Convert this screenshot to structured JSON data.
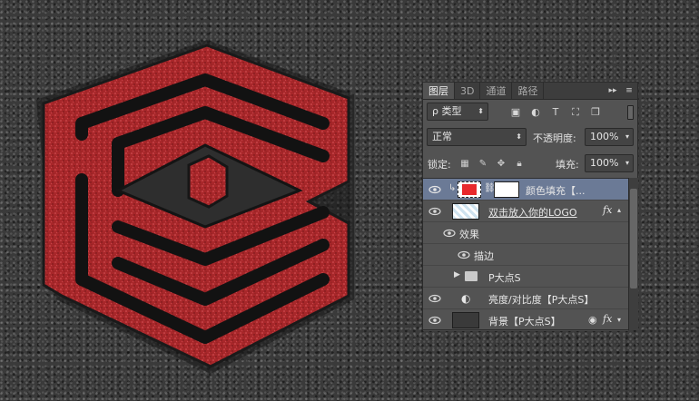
{
  "panel": {
    "tabs": [
      {
        "label": "图层",
        "active": true
      },
      {
        "label": "3D",
        "active": false
      },
      {
        "label": "通道",
        "active": false
      },
      {
        "label": "路径",
        "active": false
      }
    ],
    "filter": {
      "label": "ρ 类型"
    },
    "blend_mode": "正常",
    "opacity_label": "不透明度:",
    "opacity_value": "100%",
    "lock_label": "锁定:",
    "fill_label": "填充:",
    "fill_value": "100%",
    "layers": [
      {
        "name": "颜色填充【...",
        "type": "color-fill",
        "selected": true,
        "fill_color": "#e8292d"
      },
      {
        "name": "双击放入你的LOGO",
        "type": "smart-object",
        "has_fx": true
      },
      {
        "name": "效果",
        "type": "effects-header"
      },
      {
        "name": "描边",
        "type": "effect"
      },
      {
        "name": "P大点S",
        "type": "group"
      },
      {
        "name": "亮度/对比度【P大点S】",
        "type": "adjustment"
      },
      {
        "name": "背景【P大点S】",
        "type": "background",
        "has_fx": true
      }
    ]
  },
  "colors": {
    "logo_red": "#a8272a",
    "selection": "#6b7a96",
    "panel_bg": "#535353"
  },
  "icons": [
    "eye-icon",
    "folder-icon",
    "chain-link-icon",
    "lock-icon",
    "move-icon",
    "brush-icon",
    "fx-icon"
  ]
}
